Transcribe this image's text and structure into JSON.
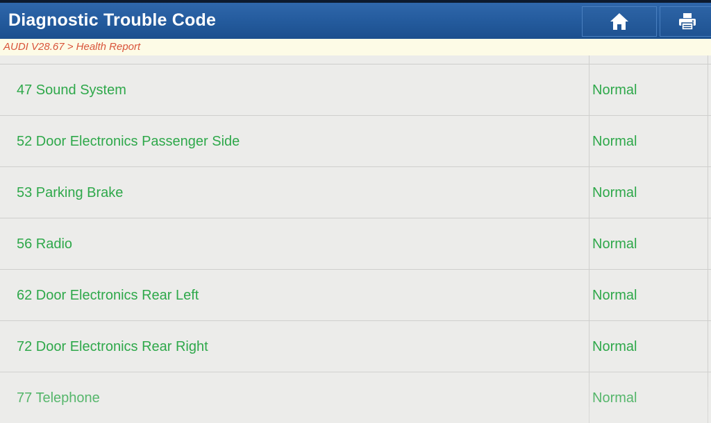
{
  "header": {
    "title": "Diagnostic Trouble Code",
    "buttons": [
      {
        "name": "home",
        "icon": "home-icon"
      },
      {
        "name": "print",
        "icon": "printer-icon"
      }
    ]
  },
  "breadcrumb": "AUDI V28.67 > Health Report",
  "rows": [
    {
      "label": "47 Sound System",
      "status": "Normal"
    },
    {
      "label": "52 Door Electronics Passenger Side",
      "status": "Normal"
    },
    {
      "label": "53 Parking Brake",
      "status": "Normal"
    },
    {
      "label": "56 Radio",
      "status": "Normal"
    },
    {
      "label": "62 Door Electronics Rear Left",
      "status": "Normal"
    },
    {
      "label": "72 Door Electronics Rear Right",
      "status": "Normal"
    },
    {
      "label": "77 Telephone",
      "status": "Normal"
    }
  ],
  "colors": {
    "header": "#235a9c",
    "breadcrumb_text": "#d9543a",
    "breadcrumb_bg": "#fdfbe6",
    "status_ok": "#2ea84a",
    "row_text": "#2ea84a",
    "background": "#ececea"
  }
}
